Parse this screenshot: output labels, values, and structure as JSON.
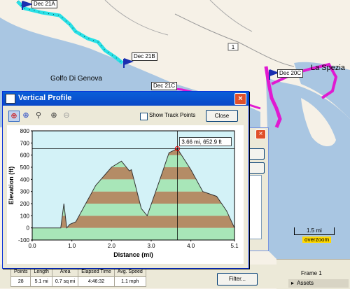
{
  "map": {
    "place_labels": [
      "Golfo Di Genova",
      "La Spezia"
    ],
    "route_marker": "1",
    "flags": [
      "Dec 21A",
      "Dec 21B",
      "Dec 21C",
      "Dec 20C"
    ],
    "scale": "1.5 mi",
    "overzoom": "overzoom",
    "colors": {
      "sea": "#a9c6e2",
      "land": "#f6f1e7",
      "track_a": "#29e0e6",
      "track_b": "#e01ad1"
    }
  },
  "dialog": {
    "title": "Vertical Profile",
    "close_x": "×",
    "tools": [
      "crosshair-red-icon",
      "crosshair-blue-icon",
      "lasso-zoom-icon",
      "zoom-in-icon",
      "zoom-out-icon"
    ],
    "show_track_points_label": "Show Track Points",
    "show_track_points_checked": false,
    "close_button": "Close"
  },
  "chart_data": {
    "type": "area",
    "xlabel": "Distance   (mi)",
    "ylabel": "Elevation (ft)",
    "xlim": [
      0,
      5.1
    ],
    "ylim": [
      -100,
      800
    ],
    "x_ticks": [
      "0.0",
      "1.0",
      "2.0",
      "3.0",
      "4.0",
      "5.1"
    ],
    "y_ticks": [
      "-100",
      "0",
      "100",
      "200",
      "300",
      "400",
      "500",
      "600",
      "700",
      "800"
    ],
    "points": [
      [
        0,
        0
      ],
      [
        0.55,
        0
      ],
      [
        0.72,
        0
      ],
      [
        0.8,
        200
      ],
      [
        0.87,
        0
      ],
      [
        0.95,
        30
      ],
      [
        1.1,
        50
      ],
      [
        1.35,
        200
      ],
      [
        1.6,
        350
      ],
      [
        2.0,
        500
      ],
      [
        2.25,
        550
      ],
      [
        2.45,
        470
      ],
      [
        2.5,
        480
      ],
      [
        2.75,
        160
      ],
      [
        2.9,
        100
      ],
      [
        3.2,
        380
      ],
      [
        3.45,
        620
      ],
      [
        3.66,
        652.9
      ],
      [
        4.0,
        480
      ],
      [
        4.3,
        300
      ],
      [
        4.65,
        260
      ],
      [
        4.9,
        140
      ],
      [
        5.1,
        0
      ]
    ],
    "cursor": {
      "x": 3.66,
      "y": 652.9,
      "label": "3.66 mi, 652.9 ft"
    },
    "band_colors": [
      "#a8e6b8",
      "#b48c66"
    ],
    "sky_color": "#d3f2f7"
  },
  "bg_panel": {
    "close_x": "×"
  },
  "stats": {
    "headers": [
      "Points",
      "Length",
      "Area",
      "Elapsed Time",
      "Avg. Speed"
    ],
    "values": [
      "28",
      "5.1 mi",
      "0.7 sq mi",
      "4:46:32",
      "1.1 mph"
    ],
    "filter_button": "Filter..."
  },
  "right_panel": {
    "frame_label": "Frame 1",
    "assets_label": "Assets"
  }
}
